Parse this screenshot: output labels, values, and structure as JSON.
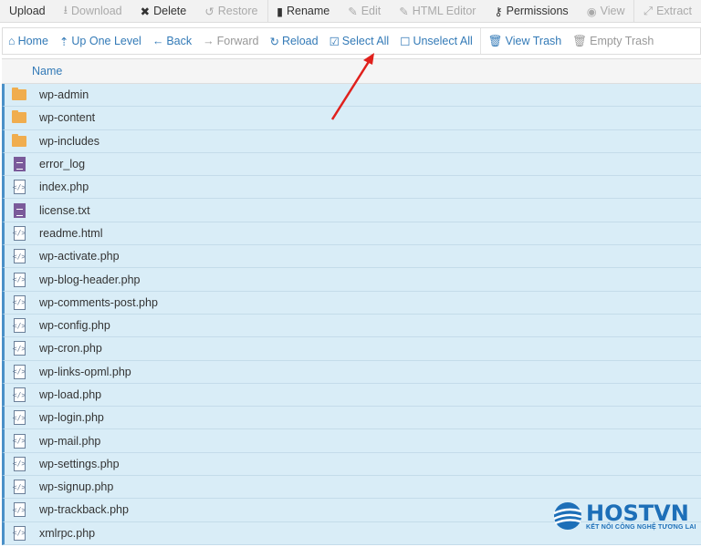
{
  "toolbar": [
    {
      "label": "Upload",
      "icon": "",
      "disabled": false
    },
    {
      "label": "Download",
      "icon": "⭳",
      "disabled": true
    },
    {
      "label": "Delete",
      "icon": "✖",
      "disabled": false
    },
    {
      "label": "Restore",
      "icon": "↺",
      "disabled": true
    },
    {
      "label": "Rename",
      "icon": "▮",
      "disabled": false,
      "sep": true
    },
    {
      "label": "Edit",
      "icon": "✎",
      "disabled": true
    },
    {
      "label": "HTML Editor",
      "icon": "✎",
      "disabled": true
    },
    {
      "label": "Permissions",
      "icon": "⚷",
      "disabled": false
    },
    {
      "label": "View",
      "icon": "◉",
      "disabled": true
    },
    {
      "label": "Extract",
      "icon": "⤢",
      "disabled": true,
      "sep": true
    }
  ],
  "nav": [
    {
      "label": "Home",
      "icon": "⌂",
      "disabled": false
    },
    {
      "label": "Up One Level",
      "icon": "⇡",
      "disabled": false
    },
    {
      "label": "Back",
      "icon": "←",
      "disabled": false
    },
    {
      "label": "Forward",
      "icon": "→",
      "disabled": true
    },
    {
      "label": "Reload",
      "icon": "↻",
      "disabled": false
    },
    {
      "label": "Select All",
      "icon": "☑",
      "disabled": false
    },
    {
      "label": "Unselect All",
      "icon": "☐",
      "disabled": false
    },
    {
      "label": "View Trash",
      "icon": "🗑",
      "disabled": false,
      "sep": true
    },
    {
      "label": "Empty Trash",
      "icon": "🗑",
      "disabled": true
    }
  ],
  "table": {
    "header": "Name"
  },
  "files": [
    {
      "name": "wp-admin",
      "type": "folder"
    },
    {
      "name": "wp-content",
      "type": "folder"
    },
    {
      "name": "wp-includes",
      "type": "folder"
    },
    {
      "name": "error_log",
      "type": "text"
    },
    {
      "name": "index.php",
      "type": "code"
    },
    {
      "name": "license.txt",
      "type": "text"
    },
    {
      "name": "readme.html",
      "type": "code"
    },
    {
      "name": "wp-activate.php",
      "type": "code"
    },
    {
      "name": "wp-blog-header.php",
      "type": "code"
    },
    {
      "name": "wp-comments-post.php",
      "type": "code"
    },
    {
      "name": "wp-config.php",
      "type": "code"
    },
    {
      "name": "wp-cron.php",
      "type": "code"
    },
    {
      "name": "wp-links-opml.php",
      "type": "code"
    },
    {
      "name": "wp-load.php",
      "type": "code"
    },
    {
      "name": "wp-login.php",
      "type": "code"
    },
    {
      "name": "wp-mail.php",
      "type": "code"
    },
    {
      "name": "wp-settings.php",
      "type": "code"
    },
    {
      "name": "wp-signup.php",
      "type": "code"
    },
    {
      "name": "wp-trackback.php",
      "type": "code"
    },
    {
      "name": "xmlrpc.php",
      "type": "code"
    }
  ],
  "logo": {
    "name": "HOSTVN",
    "tagline": "KẾT NỐI CÔNG NGHỆ TƯƠNG LAI"
  },
  "colors": {
    "selected_row": "#d9edf7",
    "link": "#337ab7",
    "annotation_arrow": "#e0201c"
  }
}
